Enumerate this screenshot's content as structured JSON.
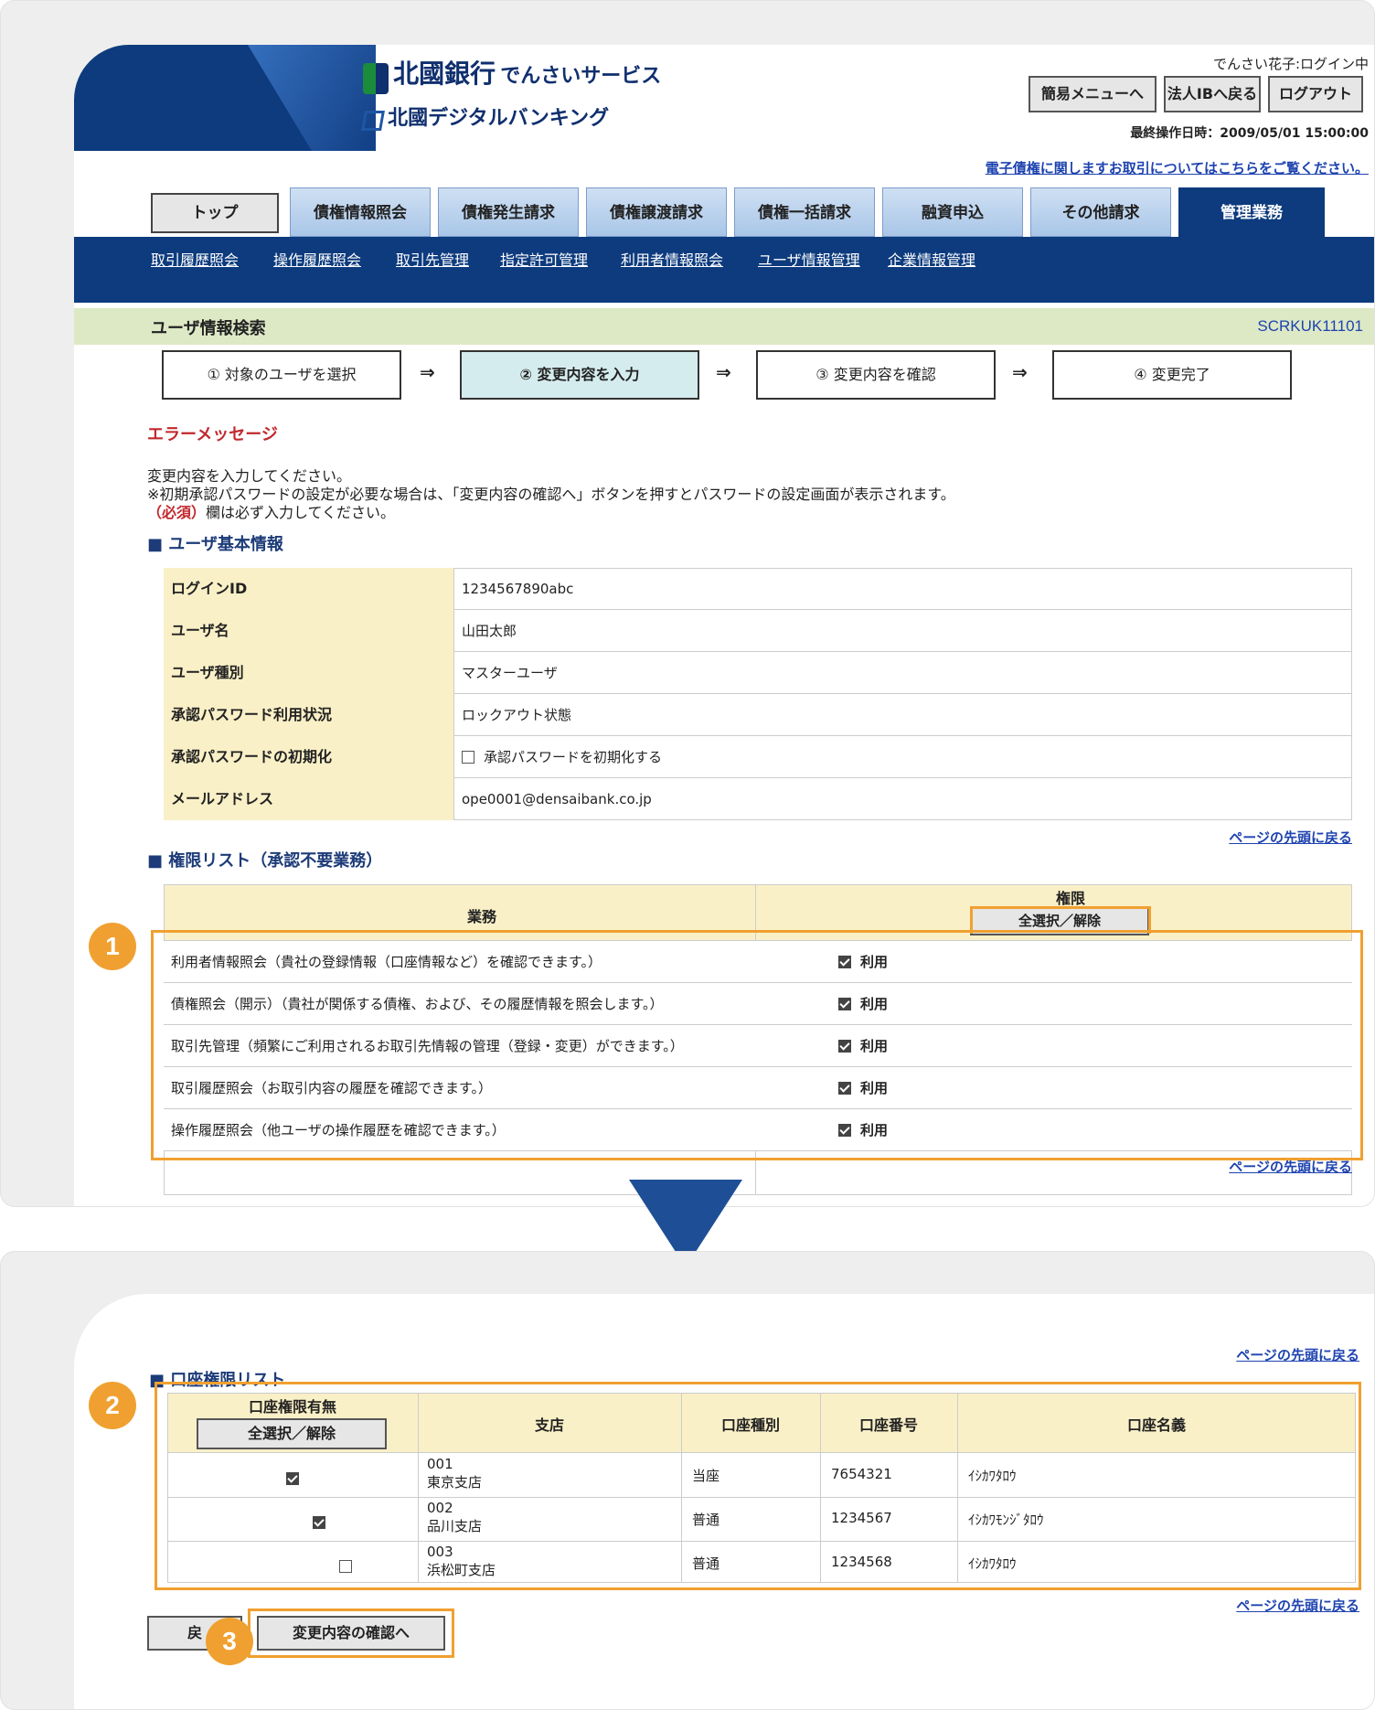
{
  "header": {
    "bank_name": "北國銀行",
    "service_name": "でんさいサービス",
    "digital_banking": "北國デジタルバンキング",
    "login_status": "でんさい花子:ログイン中",
    "buttons": [
      "簡易メニューへ",
      "法人IBへ戻る",
      "ログアウト"
    ],
    "last_operation": "最終操作日時：2009/05/01 15:00:00",
    "notice_link": "電子債権に関しますお取引についてはこちらをご覧ください。"
  },
  "tabs": [
    "トップ",
    "債権情報照会",
    "債権発生請求",
    "債権譲渡請求",
    "債権一括請求",
    "融資申込",
    "その他請求",
    "管理業務"
  ],
  "sub_links": [
    "取引履歴照会",
    "操作履歴照会",
    "取引先管理",
    "指定許可管理",
    "利用者情報照会",
    "ユーザ情報管理",
    "企業情報管理"
  ],
  "page": {
    "title": "ユーザ情報検索",
    "screen_id": "SCRKUK11101",
    "steps": [
      "① 対象のユーザを選択",
      "② 変更内容を入力",
      "③ 変更内容を確認",
      "④ 変更完了"
    ],
    "step_arrow": "⇒",
    "error_heading": "エラーメッセージ",
    "instruction1": "変更内容を入力してください。",
    "instruction2": "※初期承認パスワードの設定が必要な場合は、「変更内容の確認へ」ボタンを押すとパスワードの設定画面が表示されます。",
    "instruction3_required": "（必須）",
    "instruction3_rest": "欄は必ず入力してください。"
  },
  "user_info": {
    "heading": "■ ユーザ基本情報",
    "rows": [
      {
        "label": "ログインID",
        "value": "1234567890abc"
      },
      {
        "label": "ユーザ名",
        "value": "山田太郎"
      },
      {
        "label": "ユーザ種別",
        "value": "マスターユーザ"
      },
      {
        "label": "承認パスワード利用状況",
        "value": "ロックアウト状態"
      },
      {
        "label": "承認パスワードの初期化",
        "value": "承認パスワードを初期化する"
      },
      {
        "label": "メールアドレス",
        "value": "ope0001@densaibank.co.jp"
      }
    ]
  },
  "page_top_link": "ページの先頭に戻る",
  "permissions": {
    "heading": "■ 権限リスト（承認不要業務）",
    "col_business": "業務",
    "col_permission": "権限",
    "select_all": "全選択／解除",
    "use_label": "利用",
    "rows": [
      "利用者情報照会（貴社の登録情報（口座情報など）を確認できます。）",
      "債権照会（開示）（貴社が関係する債権、および、その履歴情報を照会します。）",
      "取引先管理（頻繁にご利用されるお取引先情報の管理（登録・変更）ができます。）",
      "取引履歴照会（お取引内容の履歴を確認できます。）",
      "操作履歴照会（他ユーザの操作履歴を確認できます。）"
    ]
  },
  "accounts": {
    "heading": "■ 口座権限リスト",
    "col_permission": "口座権限有無",
    "select_all": "全選択／解除",
    "col_branch": "支店",
    "col_type": "口座種別",
    "col_number": "口座番号",
    "col_name": "口座名義",
    "rows": [
      {
        "checked": true,
        "branch_code": "001",
        "branch": "東京支店",
        "type": "当座",
        "number": "7654321",
        "name": "ｲｼｶﾜﾀﾛｳ"
      },
      {
        "checked": true,
        "branch_code": "002",
        "branch": "品川支店",
        "type": "普通",
        "number": "1234567",
        "name": "ｲｼｶﾜﾓﾝｼﾞﾀﾛｳ"
      },
      {
        "checked": false,
        "branch_code": "003",
        "branch": "浜松町支店",
        "type": "普通",
        "number": "1234568",
        "name": "ｲｼｶﾜﾀﾛｳ"
      }
    ]
  },
  "footer": {
    "back_label": "戻",
    "confirm_label": "変更内容の確認へ"
  },
  "badges": [
    "1",
    "2",
    "3"
  ],
  "colors": {
    "navy": "#0d3b7e",
    "orange": "#f0a030",
    "accent_tab": "#0d3b7e",
    "error_red": "#c0282d"
  }
}
